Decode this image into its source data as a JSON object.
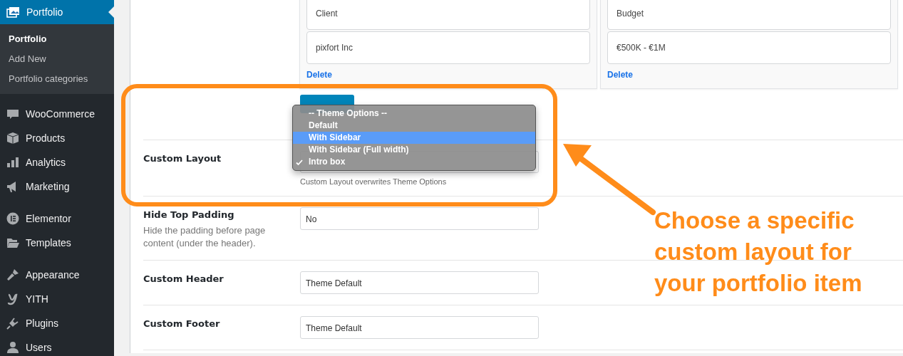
{
  "sidebar": {
    "current": {
      "label": "Portfolio",
      "submenu": [
        {
          "label": "Portfolio",
          "selected": true
        },
        {
          "label": "Add New",
          "selected": false
        },
        {
          "label": "Portfolio categories",
          "selected": false
        }
      ],
      "selected": true
    },
    "groups": [
      {
        "items": [
          {
            "label": "WooCommerce",
            "selected": false
          },
          {
            "label": "Products",
            "selected": false
          },
          {
            "label": "Analytics",
            "selected": false
          },
          {
            "label": "Marketing",
            "selected": false
          }
        ]
      },
      {
        "items": [
          {
            "label": "Elementor",
            "selected": false
          },
          {
            "label": "Templates",
            "selected": false
          }
        ]
      },
      {
        "items": [
          {
            "label": "Appearance",
            "selected": false
          },
          {
            "label": "YITH",
            "selected": false
          },
          {
            "label": "Plugins",
            "selected": false
          },
          {
            "label": "Users",
            "selected": false
          }
        ]
      }
    ]
  },
  "cards": [
    {
      "fields": [
        {
          "value": "Client"
        },
        {
          "value": "pixfort Inc"
        }
      ],
      "delete": "Delete"
    },
    {
      "fields": [
        {
          "value": "Budget"
        },
        {
          "value": "€500K - €1M"
        }
      ],
      "delete": "Delete"
    }
  ],
  "settings": [
    {
      "label": "Custom Layout",
      "hint": "Custom Layout overwrites Theme Options"
    },
    {
      "label": "Hide Top Padding",
      "description": "Hide the padding before page content (under the header).",
      "value": "No"
    },
    {
      "label": "Custom Header",
      "value": "Theme Default"
    },
    {
      "label": "Custom Footer",
      "value": "Theme Default"
    }
  ],
  "dropdown": {
    "options": [
      {
        "label": "-- Theme Options --",
        "selected": false,
        "checked": false
      },
      {
        "label": "Default",
        "selected": false,
        "checked": false
      },
      {
        "label": "With Sidebar",
        "selected": true,
        "checked": false
      },
      {
        "label": "With Sidebar (Full width)",
        "selected": false,
        "checked": false
      },
      {
        "label": "Intro box",
        "selected": false,
        "checked": true
      }
    ]
  },
  "annotation": {
    "text": "Choose a specific\ncustom layout for\nyour portfolio item"
  }
}
